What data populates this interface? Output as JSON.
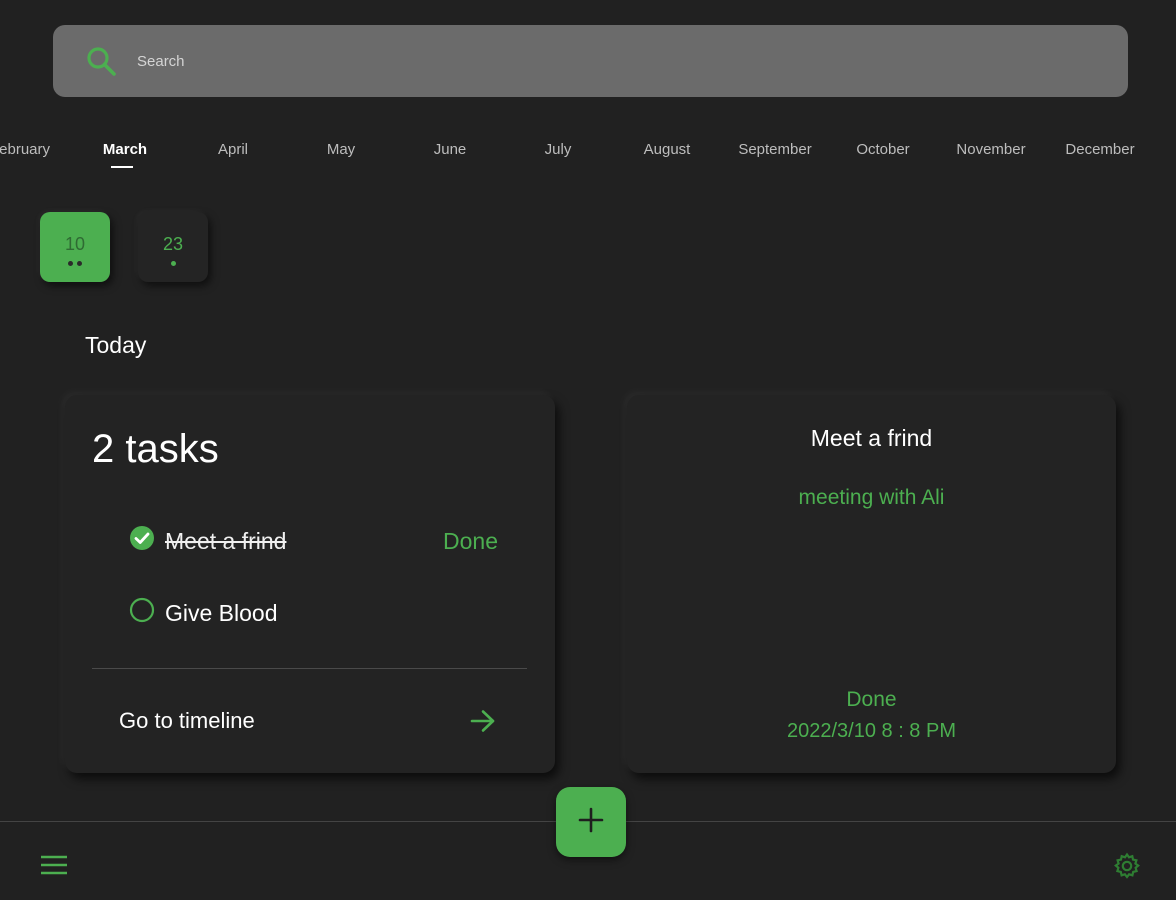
{
  "search": {
    "placeholder": "Search"
  },
  "months": [
    {
      "label": "February",
      "center_hint": "partial"
    },
    {
      "label": "March"
    },
    {
      "label": "April"
    },
    {
      "label": "May"
    },
    {
      "label": "June"
    },
    {
      "label": "July"
    },
    {
      "label": "August"
    },
    {
      "label": "September"
    },
    {
      "label": "October"
    },
    {
      "label": "November"
    },
    {
      "label": "December"
    }
  ],
  "selected_month": "March",
  "days": [
    {
      "number": "10",
      "task_dots": 2,
      "selected": true
    },
    {
      "number": "23",
      "task_dots": 1,
      "selected": false
    }
  ],
  "section_title": "Today",
  "tasks_card": {
    "count_label": "2 tasks",
    "tasks": [
      {
        "label": "Meet a frind",
        "completed": true
      },
      {
        "label": "Give Blood",
        "completed": false
      }
    ],
    "done_label": "Done",
    "timeline_link": "Go to timeline"
  },
  "detail_card": {
    "title": "Meet a frind",
    "description": "meeting with Ali",
    "status": "Done",
    "datetime": "2022/3/10  8 : 8 PM"
  },
  "colors": {
    "background": "#212121",
    "accent": "#4caf50",
    "search_bg": "#6b6b6b",
    "card_bg": "#232323"
  },
  "icons": {
    "search": "search-icon",
    "check": "check-circle-icon",
    "circle": "circle-outline-icon",
    "arrow": "arrow-right-icon",
    "add": "plus-icon",
    "menu": "hamburger-menu-icon",
    "settings": "gear-icon"
  }
}
